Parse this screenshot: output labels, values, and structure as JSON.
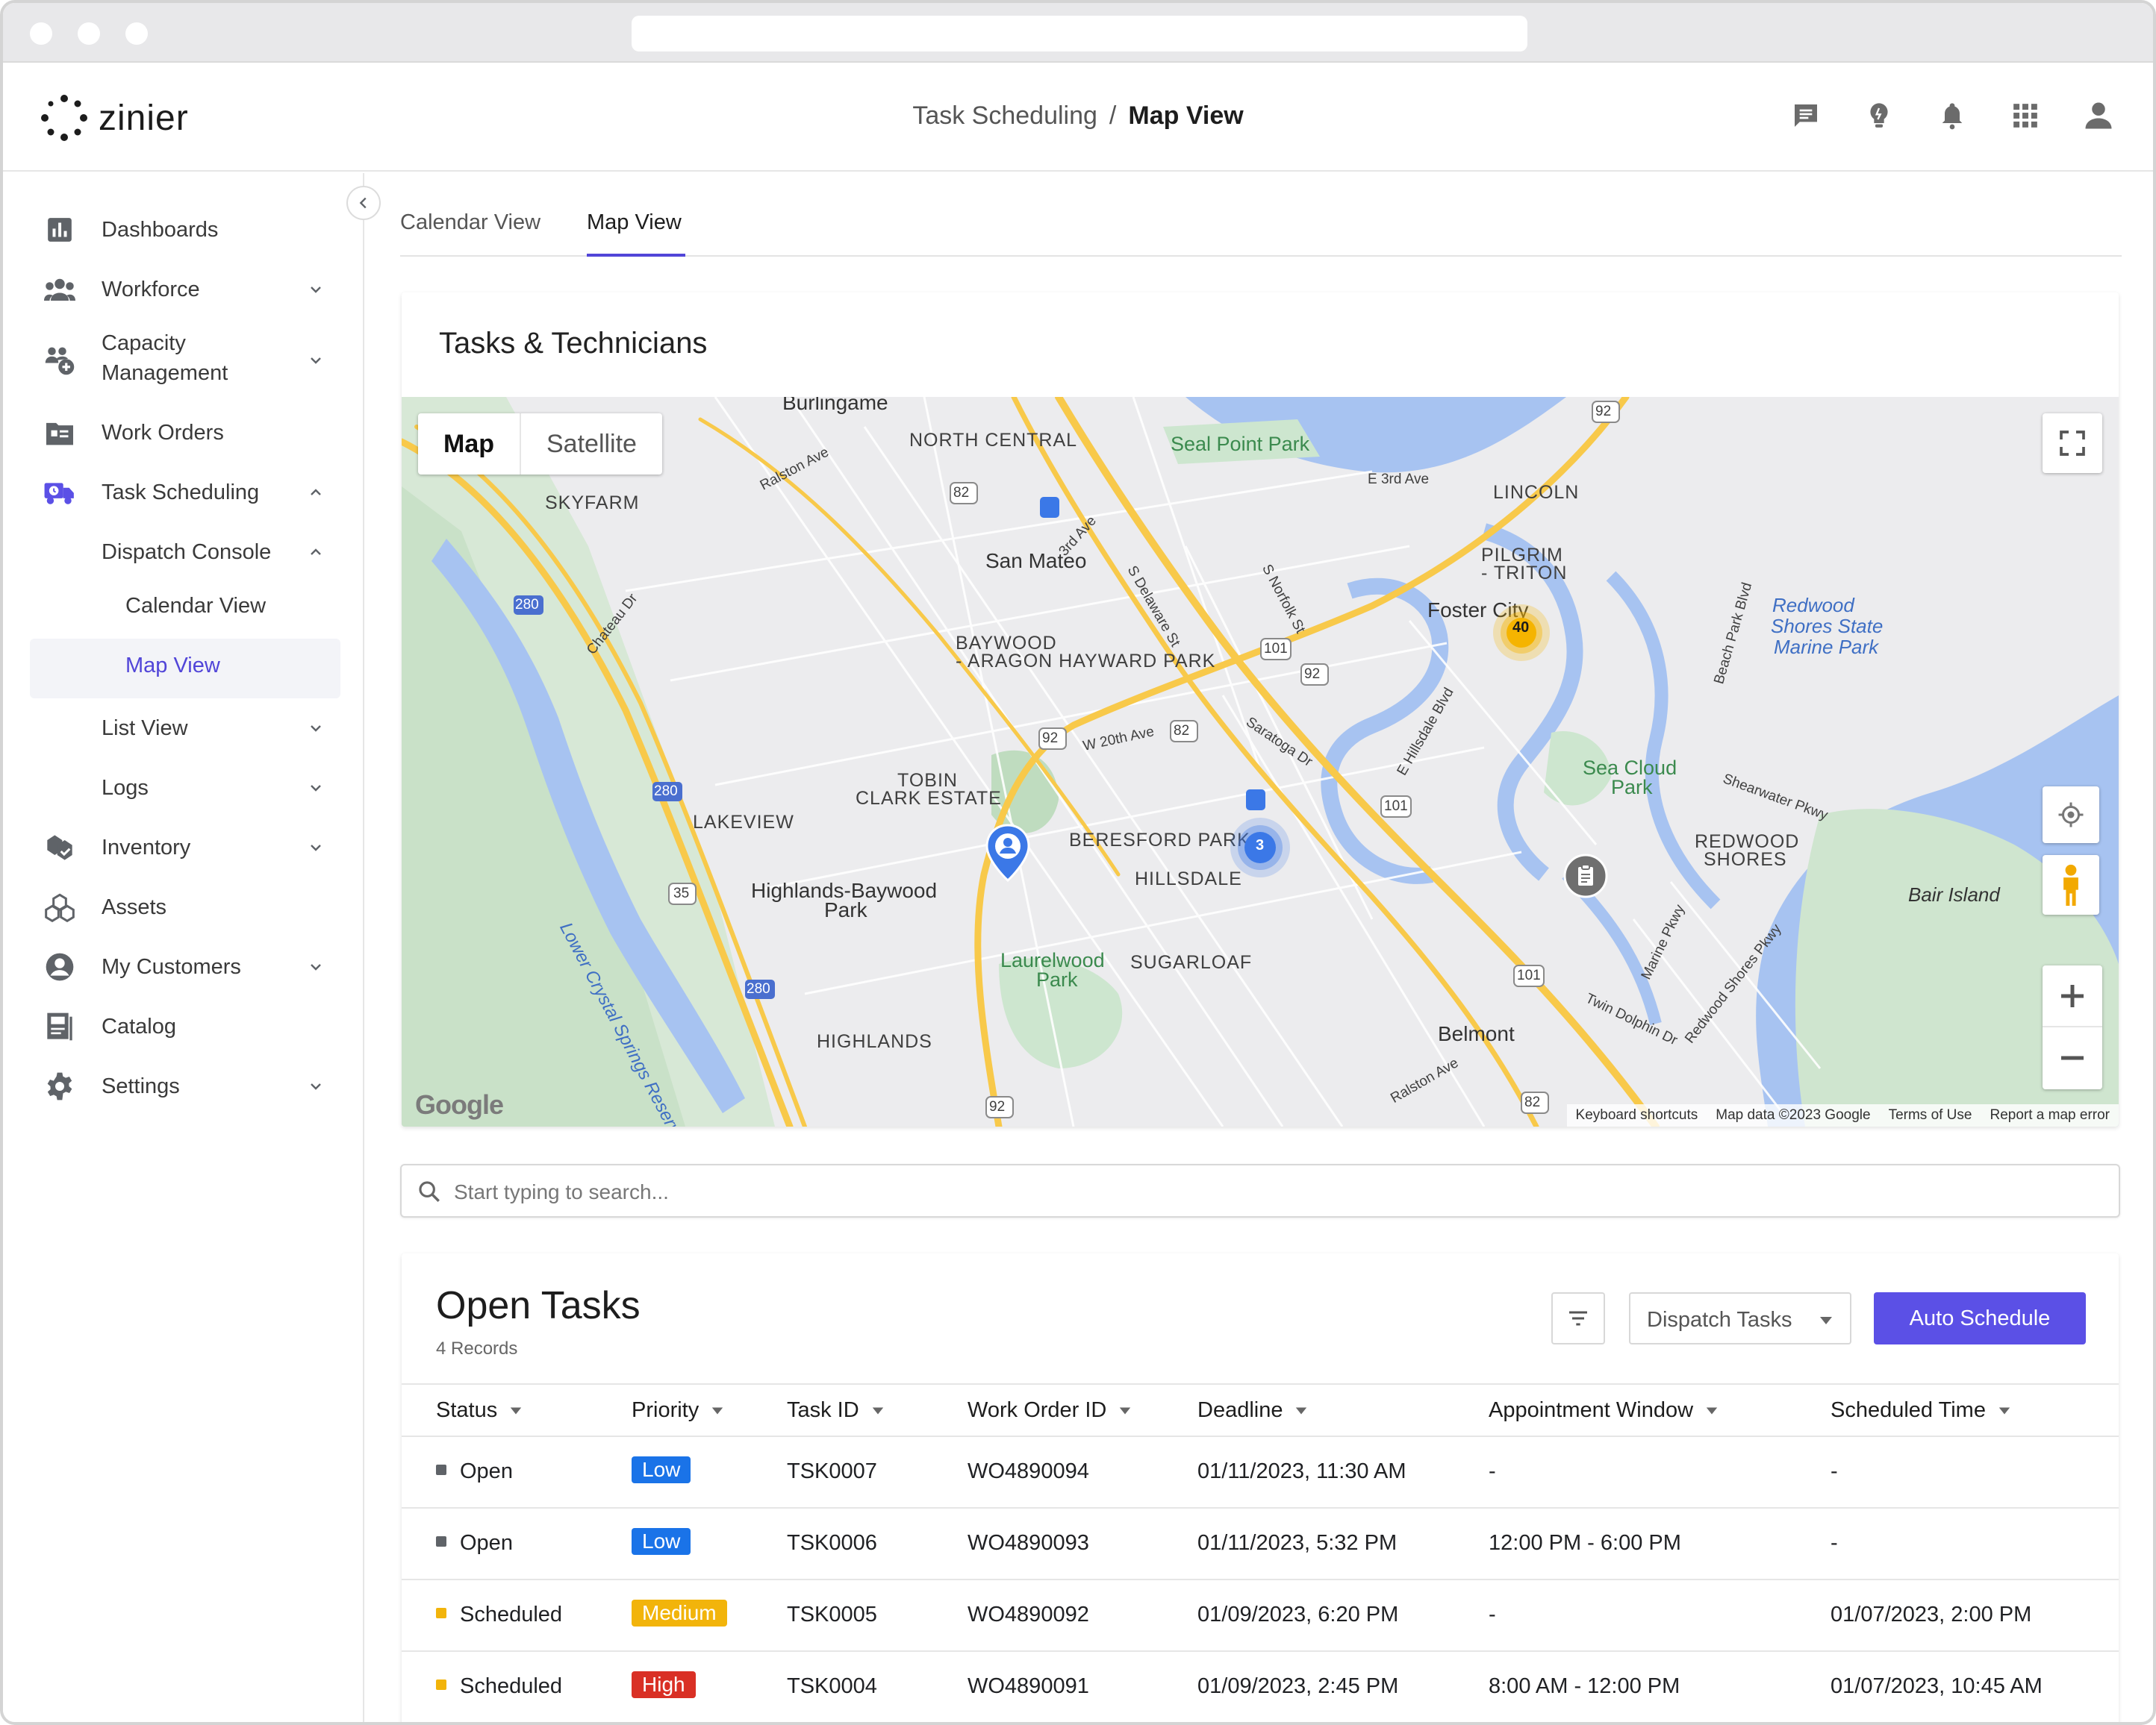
{
  "app": {
    "logo_text": "zinier",
    "breadcrumb": {
      "parent": "Task Scheduling",
      "separator": "/",
      "current": "Map View"
    }
  },
  "header_icons": [
    "chat-icon",
    "lightbulb-icon",
    "bell-icon",
    "apps-grid-icon",
    "user-icon"
  ],
  "sidebar": {
    "items": [
      {
        "label": "Dashboards",
        "icon": "dashboard-icon"
      },
      {
        "label": "Workforce",
        "icon": "workforce-icon"
      },
      {
        "label": "Capacity",
        "label2": "Management",
        "icon": "capacity-icon"
      },
      {
        "label": "Work Orders",
        "icon": "work-orders-icon"
      },
      {
        "label": "Task Scheduling",
        "icon": "truck-icon"
      },
      {
        "label": "Dispatch Console"
      },
      {
        "label": "Calendar View"
      },
      {
        "label": "Map View"
      },
      {
        "label": "List View"
      },
      {
        "label": "Logs"
      },
      {
        "label": "Inventory",
        "icon": "inventory-icon"
      },
      {
        "label": "Assets",
        "icon": "assets-icon"
      },
      {
        "label": "My Customers",
        "icon": "customer-icon"
      },
      {
        "label": "Catalog",
        "icon": "catalog-icon"
      },
      {
        "label": "Settings",
        "icon": "settings-icon"
      }
    ]
  },
  "tabs": [
    {
      "label": "Calendar View",
      "active": false
    },
    {
      "label": "Map View",
      "active": true
    }
  ],
  "map_card": {
    "title": "Tasks & Technicians",
    "toggle": {
      "map": "Map",
      "satellite": "Satellite"
    },
    "cluster_counts": {
      "foster_city": "40",
      "beresford": "3"
    },
    "labels": {
      "burlingame": "Burlingame",
      "north_central": "NORTH CENTRAL",
      "seal_point": "Seal Point Park",
      "skyfarm": "SKYFARM",
      "lincoln": "LINCOLN",
      "san_mateo": "San Mateo",
      "pilgrim": "PILGRIM",
      "triton": "- TRITON",
      "foster_city": "Foster City",
      "redwood_shores_park_1": "Redwood",
      "redwood_shores_park_2": "Shores State",
      "redwood_shores_park_3": "Marine Park",
      "baywood_1": "BAYWOOD",
      "baywood_2": "- ARAGON HAYWARD PARK",
      "tobin_1": "TOBIN",
      "tobin_2": "CLARK ESTATE",
      "lakeview": "LAKEVIEW",
      "sea_cloud_1": "Sea Cloud",
      "sea_cloud_2": "Park",
      "beresford": "BERESFORD PARK",
      "redwood_shores_1": "REDWOOD",
      "redwood_shores_2": "SHORES",
      "hillsdale": "HILLSDALE",
      "highlands_baywood_1": "Highlands-Baywood",
      "highlands_baywood_2": "Park",
      "bair_island": "Bair Island",
      "laurelwood_1": "Laurelwood",
      "laurelwood_2": "Park",
      "sugarloaf": "SUGARLOAF",
      "belmont": "Belmont",
      "highlands": "HIGHLANDS",
      "reservoir": "Lower Crystal Springs Reservoir",
      "ralston_ave": "Ralston Ave",
      "third_ave": "3rd Ave",
      "e_third_ave": "E 3rd Ave",
      "s_delaware": "S Delaware St",
      "s_norfolk": "S Norfolk St",
      "chateau_dr": "Chateau Dr",
      "w20th": "W 20th Ave",
      "saratoga": "Saratoga Dr",
      "e_hillsdale": "E Hillsdale Blvd",
      "beach_park": "Beach Park Blvd",
      "shearwater": "Shearwater Pkwy",
      "marine_pkwy": "Marine Pkwy",
      "redwood_shores_pkwy": "Redwood Shores Pkwy",
      "twin_dolphin": "Twin Dolphin Dr",
      "ralston_ave_2": "Ralston Ave"
    },
    "route_shields": [
      "92",
      "82",
      "280",
      "101",
      "35"
    ],
    "google_logo": "Google",
    "footer": [
      "Keyboard shortcuts",
      "Map data ©2023 Google",
      "Terms of Use",
      "Report a map error"
    ]
  },
  "search": {
    "placeholder": "Start typing to search..."
  },
  "tasks": {
    "title": "Open Tasks",
    "records": "4 Records",
    "dispatch_select": "Dispatch Tasks",
    "auto_schedule": "Auto Schedule",
    "columns": [
      "Status",
      "Priority",
      "Task ID",
      "Work Order ID",
      "Deadline",
      "Appointment Window",
      "Scheduled Time"
    ],
    "rows": [
      {
        "status": "Open",
        "priority": "Low",
        "task_id": "TSK0007",
        "work_order": "WO4890094",
        "deadline": "01/11/2023, 11:30 AM",
        "window": "-",
        "scheduled": "-"
      },
      {
        "status": "Open",
        "priority": "Low",
        "task_id": "TSK0006",
        "work_order": "WO4890093",
        "deadline": "01/11/2023, 5:32 PM",
        "window": "12:00 PM - 6:00 PM",
        "scheduled": "-"
      },
      {
        "status": "Scheduled",
        "priority": "Medium",
        "task_id": "TSK0005",
        "work_order": "WO4890092",
        "deadline": "01/09/2023, 6:20 PM",
        "window": "-",
        "scheduled": "01/07/2023, 2:00 PM"
      },
      {
        "status": "Scheduled",
        "priority": "High",
        "task_id": "TSK0004",
        "work_order": "WO4890091",
        "deadline": "01/09/2023, 2:45 PM",
        "window": "8:00 AM - 12:00 PM",
        "scheduled": "01/07/2023, 10:45 AM"
      }
    ]
  },
  "colors": {
    "accent": "#5b50e6",
    "status_open": "#5f6368",
    "status_scheduled": "#f2b40b",
    "priority_low": "#1a73e8",
    "priority_medium": "#f2b40b",
    "priority_high": "#d93025",
    "map_water": "#a7c3f1",
    "map_park": "#cde6cf",
    "map_highway": "#f8c94a"
  }
}
